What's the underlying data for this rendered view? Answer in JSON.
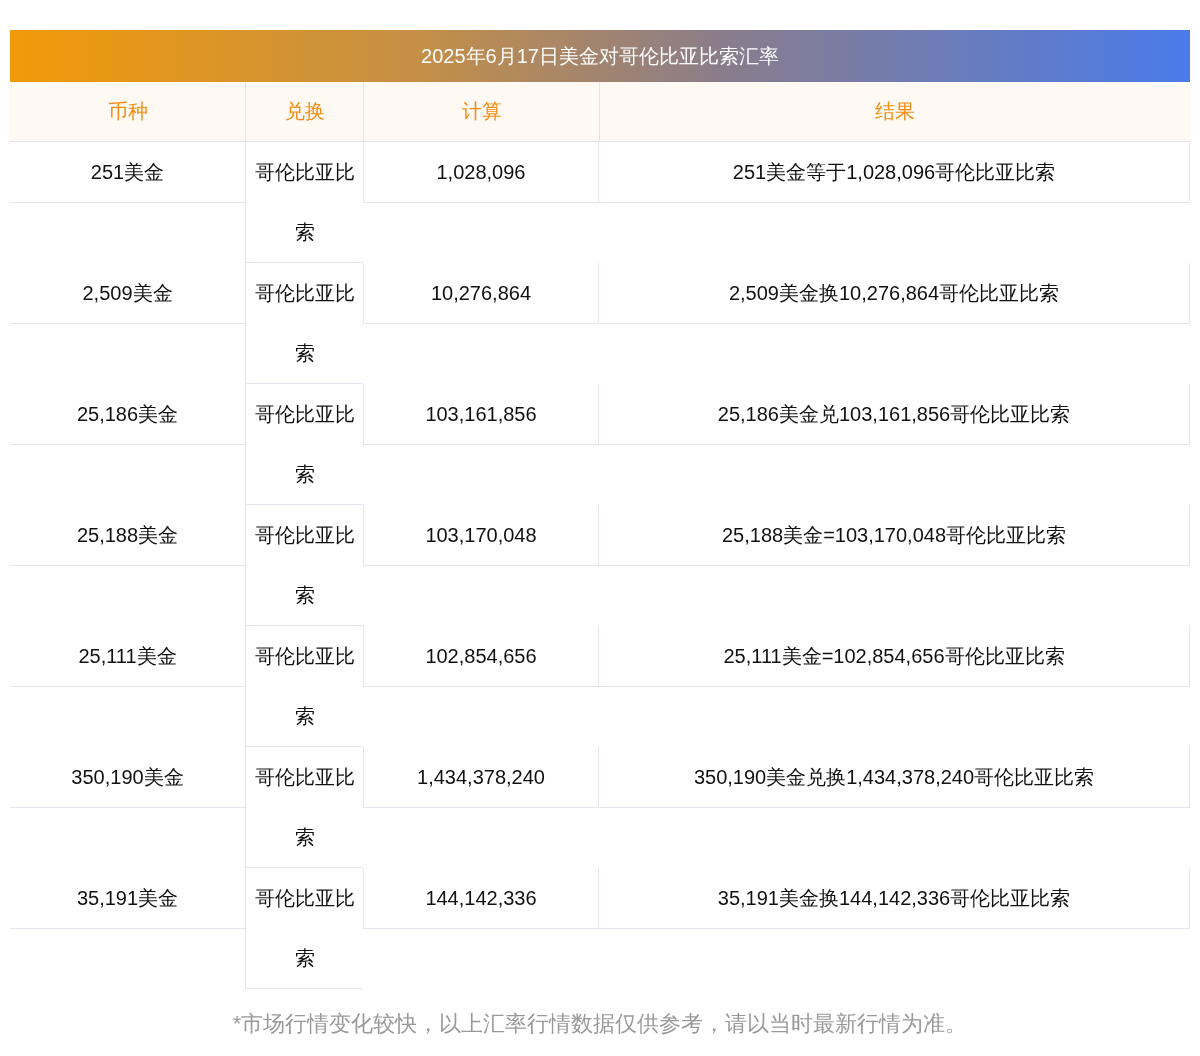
{
  "title": "2025年6月17日美金对哥伦比亚比索汇率",
  "columns": [
    "币种",
    "兑换",
    "计算",
    "结果"
  ],
  "rows": [
    {
      "currency": "251美金",
      "exchange": "哥伦比亚比索",
      "amount": "1,028,096",
      "result": "251美金等于1,028,096哥伦比亚比索"
    },
    {
      "currency": "2,509美金",
      "exchange": "哥伦比亚比索",
      "amount": "10,276,864",
      "result": "2,509美金换10,276,864哥伦比亚比索"
    },
    {
      "currency": "25,186美金",
      "exchange": "哥伦比亚比索",
      "amount": "103,161,856",
      "result": "25,186美金兑103,161,856哥伦比亚比索"
    },
    {
      "currency": "25,188美金",
      "exchange": "哥伦比亚比索",
      "amount": "103,170,048",
      "result": "25,188美金=103,170,048哥伦比亚比索"
    },
    {
      "currency": "25,111美金",
      "exchange": "哥伦比亚比索",
      "amount": "102,854,656",
      "result": "25,111美金=102,854,656哥伦比亚比索"
    },
    {
      "currency": "350,190美金",
      "exchange": "哥伦比亚比索",
      "amount": "1,434,378,240",
      "result": "350,190美金兑换1,434,378,240哥伦比亚比索"
    },
    {
      "currency": "35,191美金",
      "exchange": "哥伦比亚比索",
      "amount": "144,142,336",
      "result": "35,191美金换144,142,336哥伦比亚比索"
    }
  ],
  "footnote": "*市场行情变化较快，以上汇率行情数据仅供参考，请以当时最新行情为准。"
}
